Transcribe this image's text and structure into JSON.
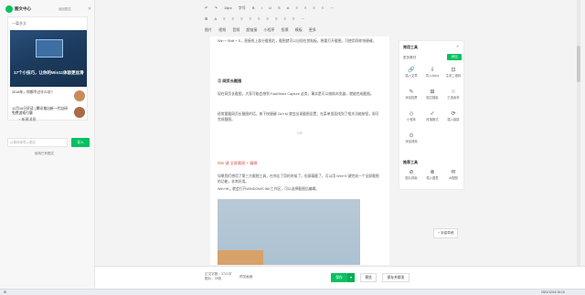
{
  "sidebar": {
    "title": "图文中心",
    "back_label": "返回图文 ",
    "close_icon": "close-icon",
    "collection_label": "一篇多文",
    "cover_title": "17个小技巧，让你的Win11体验更丝滑",
    "items": [
      {
        "text": "2018年，你都令过什么坑?"
      },
      {
        "text": "12月16日早读 | 腾讯推出新一代自研免费游戏引擎"
      }
    ],
    "add_label": "+ 新建消息",
    "search_placeholder": "从素材库导入图文",
    "import_label": "导入",
    "hint": "使用已有图文"
  },
  "toolbar": {
    "row1": [
      "↶",
      "↷",
      "15px",
      "字号",
      "B",
      "I",
      "U",
      "S",
      "A",
      "≡",
      "≡",
      "≡",
      "≡",
      "⋯"
    ],
    "row2": [
      "⊞",
      "A",
      "≡",
      "≡",
      "≡",
      "≡",
      "≡",
      "≡",
      "≡",
      "≡",
      "≡",
      "⋯"
    ],
    "row3": [
      "图片",
      "视频",
      "音频",
      "超链接",
      "小程序",
      "投票",
      "模板",
      "更多"
    ]
  },
  "article": {
    "intro": "Win + Shift + S，直接框上部分截图后，截图就可以出现在剪贴板。想要打开截图，可使用同样快捷键。",
    "heading": "② 网页长截图",
    "para1": "现在网页长截图，大家可能会想到 FastStone Capture 这类，事实是可以借助浏览器，就能完成截图。",
    "para2": "经常要截网页长截图的话，按下快捷键 Ctrl+M 就会出现截图设置；在菜单里面找到了相关功能按钮，即可完成截图。",
    "gif_label": "GIF",
    "red_heading": "Win 键 全屏截图 + 编辑",
    "para3": "如果我们想用了第三方截图工具，在你忘了用的时候了，但屏幕截了，可以用 Win+S 键完成一个全屏截图的功能，非常好用。",
    "para4": "Win+W，就会打开WINDOWS INK工作区，可以选择截图后编辑。"
  },
  "tools": {
    "title": "常用工具",
    "close": "✕",
    "info": "更多素材",
    "btn": "添加",
    "cells": [
      {
        "icon": "🔗",
        "label": "插入文章"
      },
      {
        "icon": "⇩",
        "label": "导入Word"
      },
      {
        "icon": "⊡",
        "label": "生成二维码"
      },
      {
        "icon": "✎",
        "label": "添加投票"
      },
      {
        "icon": "⊞",
        "label": "图文模板"
      },
      {
        "icon": "☆",
        "label": "已选素材"
      },
      {
        "icon": "◇",
        "label": "小程序"
      },
      {
        "icon": "✓",
        "label": "段落格式"
      },
      {
        "icon": "⟳",
        "label": "插入链接"
      },
      {
        "icon": "⊙",
        "label": "添加视频"
      }
    ],
    "sub_title": "推荐工具",
    "sub_cells": [
      {
        "icon": "⊘",
        "label": "图片排版"
      },
      {
        "icon": "⊗",
        "label": "插入图表"
      },
      {
        "icon": "✉",
        "label": "AI配图"
      }
    ]
  },
  "newdraft_label": "+ 新建草稿",
  "bottombar": {
    "count": "正文字数：3721字",
    "count2": "图片：39张",
    "preview_ratio": "预览画面",
    "save": "保存",
    "preview": "预览",
    "publish": "保存并群发"
  },
  "taskbar": {
    "left": "⊞",
    "right": "2021/12/16 16:10"
  }
}
